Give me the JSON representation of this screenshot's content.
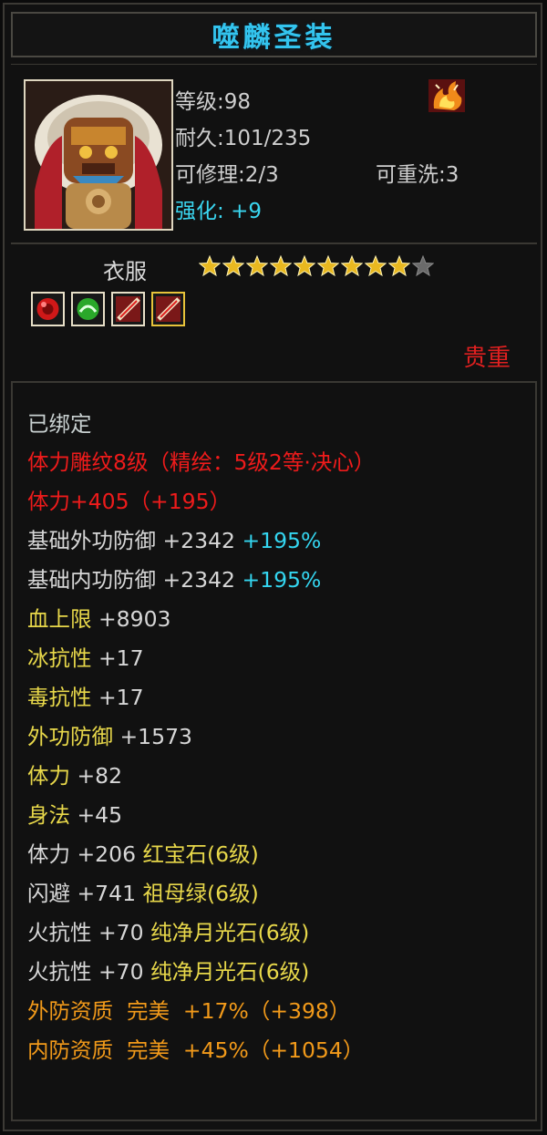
{
  "item": {
    "name": "噬麟圣装",
    "level_label": "等级:98",
    "durability_label": "耐久:101/235",
    "repair_label": "可修理:2/3",
    "rewash_label": "可重洗:3",
    "enhance_label": "强化:",
    "enhance_value": "+9",
    "slot": "衣服",
    "stars_filled": 9,
    "stars_total": 10,
    "rarity": "贵重"
  },
  "gems": [
    {
      "icon": "red-gem-icon"
    },
    {
      "icon": "green-gem-icon"
    },
    {
      "icon": "moonstone-gem-icon"
    },
    {
      "icon": "moonstone-gem-icon"
    }
  ],
  "attributes": {
    "bound": "已绑定",
    "engrave": "体力雕纹8级（精绘：5级2等·决心）",
    "vit_main": "体力+405（+195）",
    "phys_def_base_label": "基础外功防御 +2342",
    "phys_def_base_pct": "+195%",
    "mag_def_base_label": "基础内功防御 +2342",
    "mag_def_base_pct": "+195%",
    "hp_max_label": "血上限",
    "hp_max_val": "+8903",
    "ice_res_label": "冰抗性",
    "ice_res_val": "+17",
    "poison_res_label": "毒抗性",
    "poison_res_val": "+17",
    "phys_def_label": "外功防御",
    "phys_def_val": "+1573",
    "vit_label": "体力",
    "vit_val": "+82",
    "agi_label": "身法",
    "agi_val": "+45",
    "gem1_stat": "体力 +206",
    "gem1_name": "红宝石(6级)",
    "gem2_stat": "闪避 +741",
    "gem2_name": "祖母绿(6级)",
    "gem3_stat": "火抗性 +70",
    "gem3_name": "纯净月光石(6级)",
    "gem4_stat": "火抗性 +70",
    "gem4_name": "纯净月光石(6级)",
    "qual1_label": "外防资质",
    "qual1_val": "完美  +17%（+398）",
    "qual2_label": "内防资质",
    "qual2_val": "完美  +45%（+1054）"
  },
  "colors": {
    "title": "#33c4ee",
    "enhance": "#3ad6f0",
    "red": "#ee1b1b",
    "yellow": "#e8d84a",
    "orange": "#f29a1a",
    "star": "#e8b820"
  }
}
